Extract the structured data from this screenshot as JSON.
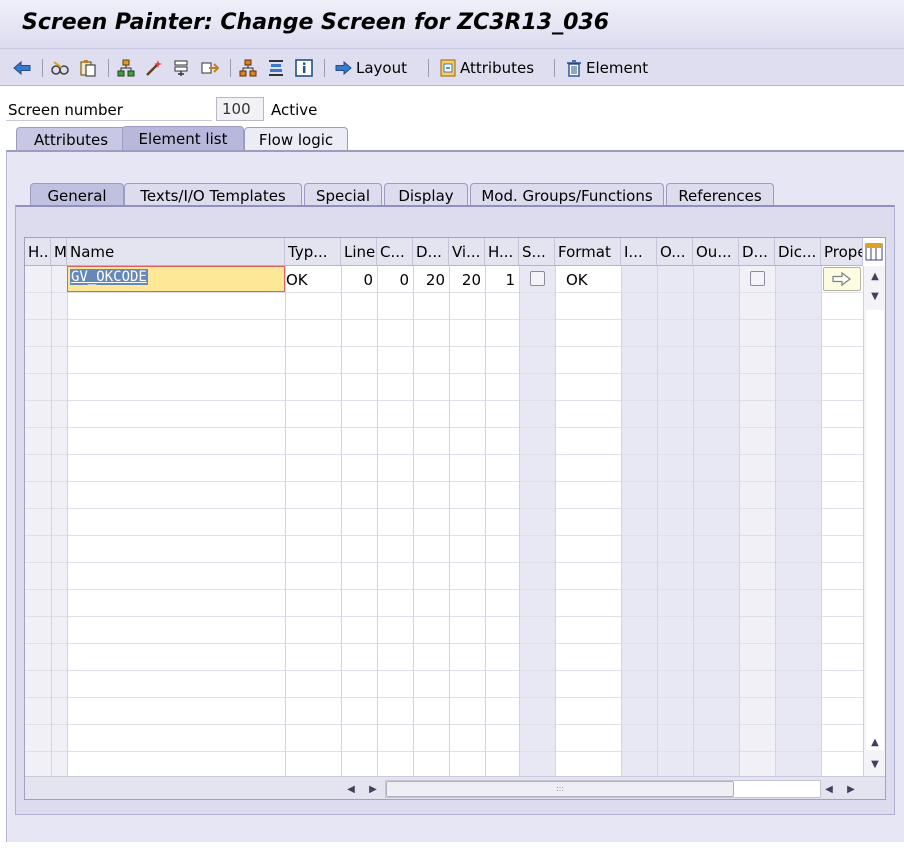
{
  "window": {
    "title": "Screen Painter: Change Screen for ZC3R13_036"
  },
  "toolbar": {
    "layout_label": "Layout",
    "attributes_label": "Attributes",
    "element_label": "Element"
  },
  "screen": {
    "number_label": "Screen number",
    "number_value": "100",
    "status": "Active"
  },
  "main_tabs": [
    {
      "label": "Attributes",
      "active": false
    },
    {
      "label": "Element list",
      "active": true
    },
    {
      "label": "Flow logic",
      "active": false
    }
  ],
  "sub_tabs": [
    {
      "label": "General",
      "active": true
    },
    {
      "label": "Texts/I/O Templates",
      "active": false
    },
    {
      "label": "Special",
      "active": false
    },
    {
      "label": "Display",
      "active": false
    },
    {
      "label": "Mod. Groups/Functions",
      "active": false
    },
    {
      "label": "References",
      "active": false
    }
  ],
  "table": {
    "headers": [
      "H...",
      "M",
      "Name",
      "Typ...",
      "Line",
      "C...",
      "D...",
      "Vi...",
      "H...",
      "S...",
      "Format",
      "I...",
      "O...",
      "Ou...",
      "D...",
      "Dic...",
      "Prope"
    ],
    "rows": [
      {
        "name": "GV_OKCODE",
        "type": "OK",
        "line": "0",
        "column": "0",
        "defined_length": "20",
        "visible_length": "20",
        "height": "1",
        "scrollable": false,
        "format": "OK",
        "dict_checkbox": false
      }
    ]
  },
  "colors": {
    "title_bg": "#dcdcf0",
    "panel_bg": "#dcdcee",
    "selected_cell": "#fde898",
    "selection_text_bg": "#6688b8"
  }
}
